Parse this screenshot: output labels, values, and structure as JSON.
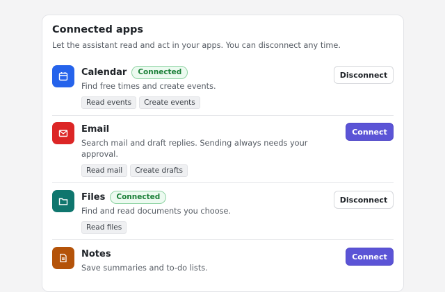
{
  "header": {
    "title": "Connected apps",
    "subtitle": "Let the assistant read and act in your apps. You can disconnect any time."
  },
  "apps": [
    {
      "name": "Calendar",
      "icon": "calendar-icon",
      "icon_color": "#2563eb",
      "status": "Connected",
      "description": "Find free times and create events.",
      "permissions": [
        "Read events",
        "Create events"
      ],
      "action": "Disconnect"
    },
    {
      "name": "Email",
      "icon": "mail-icon",
      "icon_color": "#dc2626",
      "status": "",
      "description": "Search mail and draft replies. Sending always needs your approval.",
      "permissions": [
        "Read mail",
        "Create drafts"
      ],
      "action": "Connect"
    },
    {
      "name": "Files",
      "icon": "folder-icon",
      "icon_color": "#0f766e",
      "status": "Connected",
      "description": "Find and read documents you choose.",
      "permissions": [
        "Read files"
      ],
      "action": "Disconnect"
    },
    {
      "name": "Notes",
      "icon": "note-icon",
      "icon_color": "#b45309",
      "status": "",
      "description": "Save summaries and to-do lists.",
      "permissions": [],
      "action": "Connect"
    }
  ],
  "colors": {
    "connect_button": "#5b54d6",
    "connected_badge": "#1a7f37"
  }
}
